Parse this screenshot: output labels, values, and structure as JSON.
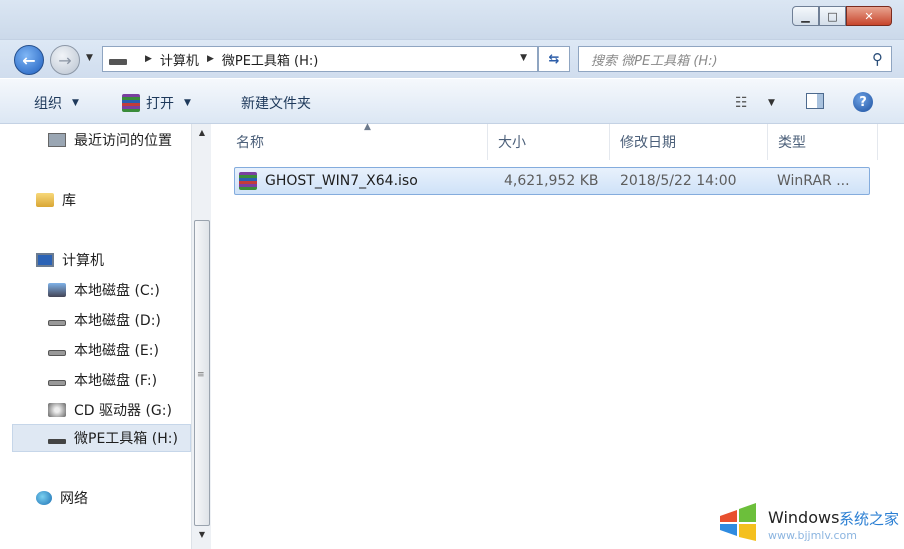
{
  "window": {
    "min_glyph": "▁",
    "max_glyph": "□",
    "close_glyph": "✕"
  },
  "address": {
    "back_glyph": "←",
    "forward_glyph": "→",
    "crumb_computer": "计算机",
    "crumb_drive": "微PE工具箱 (H:)",
    "refresh_glyph": "⇆",
    "search_placeholder": "搜索 微PE工具箱 (H:)",
    "search_icon": "⚲"
  },
  "toolbar": {
    "organize": "组织",
    "open": "打开",
    "new_folder": "新建文件夹",
    "view_glyph": "☷",
    "help_glyph": "?"
  },
  "navigation": {
    "items": [
      {
        "label": "最近访问的位置",
        "icon": "recent-places-icon"
      },
      {
        "label": "库",
        "icon": "library-icon"
      },
      {
        "label": "计算机",
        "icon": "computer-icon"
      },
      {
        "label": "本地磁盘 (C:)",
        "icon": "system-disk-icon"
      },
      {
        "label": "本地磁盘 (D:)",
        "icon": "disk-icon"
      },
      {
        "label": "本地磁盘 (E:)",
        "icon": "disk-icon"
      },
      {
        "label": "本地磁盘 (F:)",
        "icon": "disk-icon"
      },
      {
        "label": "CD 驱动器 (G:)",
        "icon": "cd-drive-icon"
      },
      {
        "label": "微PE工具箱 (H:)",
        "icon": "usb-drive-icon",
        "selected": true
      },
      {
        "label": "网络",
        "icon": "network-icon"
      }
    ]
  },
  "columns": {
    "name": "名称",
    "size": "大小",
    "modified": "修改日期",
    "type": "类型"
  },
  "files": [
    {
      "name": "GHOST_WIN7_X64.iso",
      "size": "4,621,952 KB",
      "modified": "2018/5/22 14:00",
      "type": "WinRAR ..."
    }
  ],
  "watermark": {
    "brand": "Windows",
    "site": "系统之家",
    "url": "www.bjjmlv.com"
  }
}
